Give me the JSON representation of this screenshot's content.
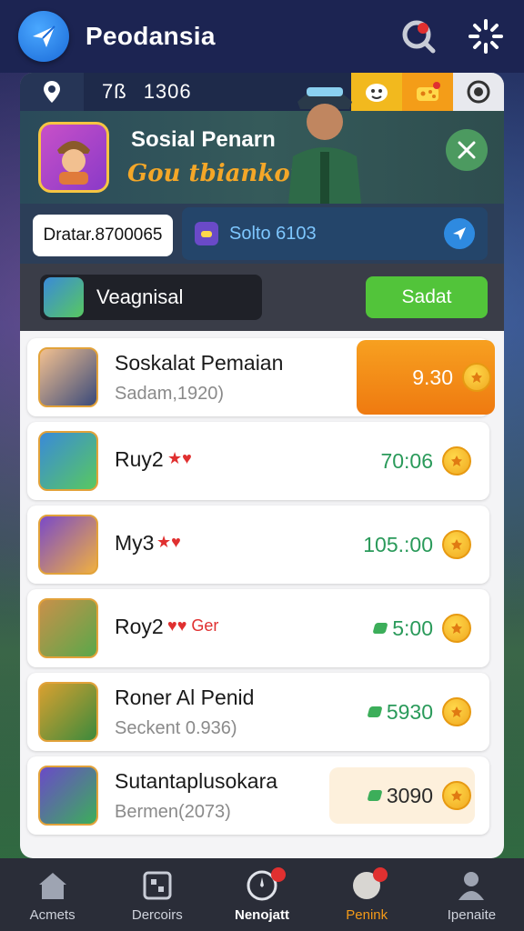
{
  "header": {
    "title": "Peodansia",
    "logo_icon": "paper-plane-icon",
    "icons": [
      "search-icon",
      "loading-spinner-icon"
    ]
  },
  "top_strip": {
    "location_icon": "map-pin-icon",
    "coords": [
      "7ß",
      "1306"
    ],
    "buttons": [
      "emoji-icon",
      "gift-icon",
      "settings-icon"
    ]
  },
  "hero": {
    "title": "Sosial Penarn",
    "subtitle": "Gou tbiankon2",
    "close_icon": "close-icon"
  },
  "score_row": {
    "score_text": "Dratar.8700065",
    "solo_label": "Solto 6103",
    "send_icon": "send-icon"
  },
  "search": {
    "placeholder": "Veagnisal",
    "button_label": "Sadat"
  },
  "leaderboard": [
    {
      "name": "Soskalat Pemaian",
      "sub": "Sadam,1920)",
      "score": "9.30",
      "highlight": "orange",
      "has_gem": false,
      "extras": ""
    },
    {
      "name": "Ruy2",
      "sub": "",
      "score": "70:06",
      "highlight": "none",
      "has_gem": false,
      "extras": "★♥"
    },
    {
      "name": "My3",
      "sub": "",
      "score": "105.:00",
      "highlight": "none",
      "has_gem": false,
      "extras": "★♥"
    },
    {
      "name": "Roy2",
      "sub": "",
      "score": "5:00",
      "highlight": "none",
      "has_gem": true,
      "extras": "♥♥ Ger"
    },
    {
      "name": "Roner Al Penid",
      "sub": "Seckent 0.936)",
      "score": "5930",
      "highlight": "none",
      "has_gem": true,
      "extras": ""
    },
    {
      "name": "Sutantaplusokara",
      "sub": "Bermen(2073)",
      "score": "3090",
      "highlight": "cream",
      "has_gem": true,
      "extras": ""
    }
  ],
  "bottom_nav": [
    {
      "label": "Acmets",
      "icon": "home-icon",
      "state": "normal"
    },
    {
      "label": "Dercoirs",
      "icon": "grid-icon",
      "state": "normal"
    },
    {
      "label": "Nenojatt",
      "icon": "compass-icon",
      "state": "bold"
    },
    {
      "label": "Penink",
      "icon": "trophy-icon",
      "state": "active"
    },
    {
      "label": "Ipenaite",
      "icon": "profile-icon",
      "state": "normal"
    }
  ],
  "colors": {
    "header_bg": "#1c2452",
    "accent_orange": "#f49a18",
    "accent_green": "#52c43a",
    "score_green": "#2a9a5a"
  }
}
